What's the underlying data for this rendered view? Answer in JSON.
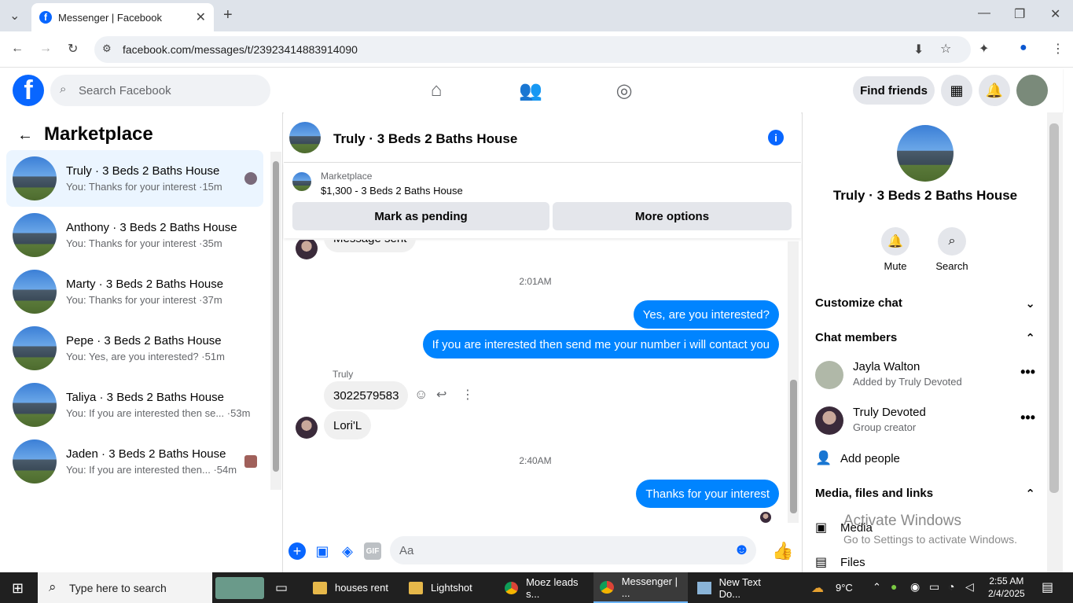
{
  "browser": {
    "tab_title": "Messenger | Facebook",
    "url": "facebook.com/messages/t/23923414883914090"
  },
  "header": {
    "search_placeholder": "Search Facebook",
    "find_friends": "Find friends"
  },
  "sidebar": {
    "title": "Marketplace",
    "conversations": [
      {
        "title": "Truly · 3 Beds 2 Baths House",
        "preview": "You: Thanks for your interest",
        "time": "·15m"
      },
      {
        "title": "Anthony · 3 Beds 2 Baths House",
        "preview": "You: Thanks for your interest",
        "time": "·35m"
      },
      {
        "title": "Marty · 3 Beds 2 Baths House",
        "preview": "You: Thanks for your interest",
        "time": "·37m"
      },
      {
        "title": "Pepe · 3 Beds 2 Baths House",
        "preview": "You: Yes, are you interested?",
        "time": "·51m"
      },
      {
        "title": "Taliya · 3 Beds 2 Baths House",
        "preview": "You: If you are interested then se...",
        "time": "·53m"
      },
      {
        "title": "Jaden · 3 Beds 2 Baths House",
        "preview": "You: If you are interested then...",
        "time": "·54m"
      }
    ]
  },
  "chat": {
    "title": "Truly · 3 Beds 2 Baths House",
    "marketplace_label": "Marketplace",
    "listing": "$1,300 - 3 Beds 2 Baths House",
    "mark_pending": "Mark as pending",
    "more_options": "More options",
    "messages": {
      "partial": "Message sent",
      "time1": "2:01AM",
      "out1": "Yes, are you interested?",
      "out2": "If you are interested then send me your number i will contact you",
      "sender": "Truly",
      "in1": "3022579583",
      "in2": "Lori'L",
      "time2": "2:40AM",
      "out3": "Thanks for your interest"
    },
    "input_placeholder": "Aa"
  },
  "details": {
    "title": "Truly · 3 Beds 2 Baths House",
    "mute": "Mute",
    "search": "Search",
    "customize": "Customize chat",
    "members_heading": "Chat members",
    "members": [
      {
        "name": "Jayla Walton",
        "role": "Added by Truly Devoted"
      },
      {
        "name": "Truly Devoted",
        "role": "Group creator"
      }
    ],
    "add_people": "Add people",
    "media_heading": "Media, files and links",
    "media": "Media",
    "files": "Files"
  },
  "watermark": {
    "line1": "Activate Windows",
    "line2": "Go to Settings to activate Windows."
  },
  "taskbar": {
    "search": "Type here to search",
    "items": [
      "houses rent",
      "Lightshot",
      "Moez leads s...",
      "Messenger | ...",
      "New Text Do..."
    ],
    "weather": "9°C",
    "time": "2:55 AM",
    "date": "2/4/2025"
  },
  "colors": {
    "accent": "#0866ff",
    "bubble_out": "#0084ff"
  }
}
